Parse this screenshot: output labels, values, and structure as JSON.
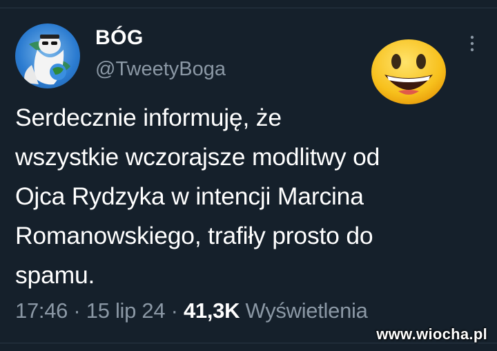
{
  "tweet": {
    "author": {
      "display_name": "BÓG",
      "handle": "@TweetyBoga"
    },
    "text_lines": [
      "Serdecznie informuję, że",
      "wszystkie wczorajsze modlitwy od",
      "Ojca Rydzyka w intencji Marcina",
      "Romanowskiego, trafiły prosto do",
      "spamu."
    ],
    "time": "17:46",
    "separator": "·",
    "date": "15 lip 24",
    "views_count": "41,3K",
    "views_label": "Wyświetlenia"
  },
  "icons": {
    "more": "more-vertical-icon",
    "emoji": "grinning-face-emoji"
  },
  "watermark": "www.wiocha.pl",
  "colors": {
    "background": "#15202b",
    "text_primary": "#ffffff",
    "text_secondary": "#8b98a5",
    "divider": "#2a3744"
  }
}
